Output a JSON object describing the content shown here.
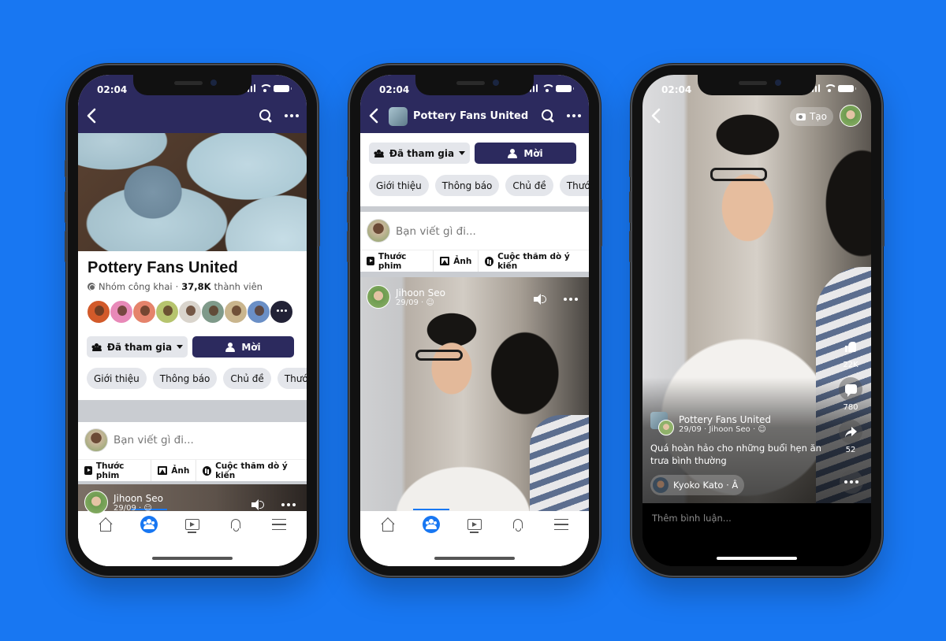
{
  "background_color": "#1877f2",
  "status_bar": {
    "time": "02:04"
  },
  "group": {
    "name": "Pottery Fans United",
    "privacy": "Nhóm công khai",
    "separator": "·",
    "member_count": "37,8K",
    "member_label": "thành viên",
    "member_avatar_count_shown": 9
  },
  "buttons": {
    "joined": "Đã tham gia",
    "invite": "Mời"
  },
  "chips": [
    "Giới thiệu",
    "Thông báo",
    "Chủ đề",
    "Thước phim"
  ],
  "composer": {
    "placeholder": "Bạn viết gì đi...",
    "actions": [
      "Thước phim",
      "Ảnh",
      "Cuộc thăm dò ý kiến"
    ]
  },
  "post": {
    "author": "Jihoon Seo",
    "date": "29/09",
    "separator": "·"
  },
  "tabbar": {
    "tabs": [
      {
        "name": "home",
        "icon": "home-icon",
        "active": false
      },
      {
        "name": "groups",
        "icon": "groups-icon",
        "active": true
      },
      {
        "name": "video",
        "icon": "video-icon",
        "active": false
      },
      {
        "name": "notifications",
        "icon": "bell-icon",
        "active": false
      },
      {
        "name": "menu",
        "icon": "menu-icon",
        "active": false
      }
    ]
  },
  "reel": {
    "create_label": "Tạo",
    "group_name": "Pottery Fans United",
    "meta": "29/09 · Jihoon Seo ·",
    "caption": "Quá hoàn hảo cho những buổi hẹn ăn trưa bình thường",
    "audio": "Kyoko Kato · Â",
    "likes": "22K",
    "comments": "780",
    "shares": "52",
    "comment_placeholder": "Thêm bình luận..."
  },
  "colors": {
    "navy": "#2c2a5e",
    "accent": "#1877f2",
    "chip_bg": "#e4e6eb"
  }
}
